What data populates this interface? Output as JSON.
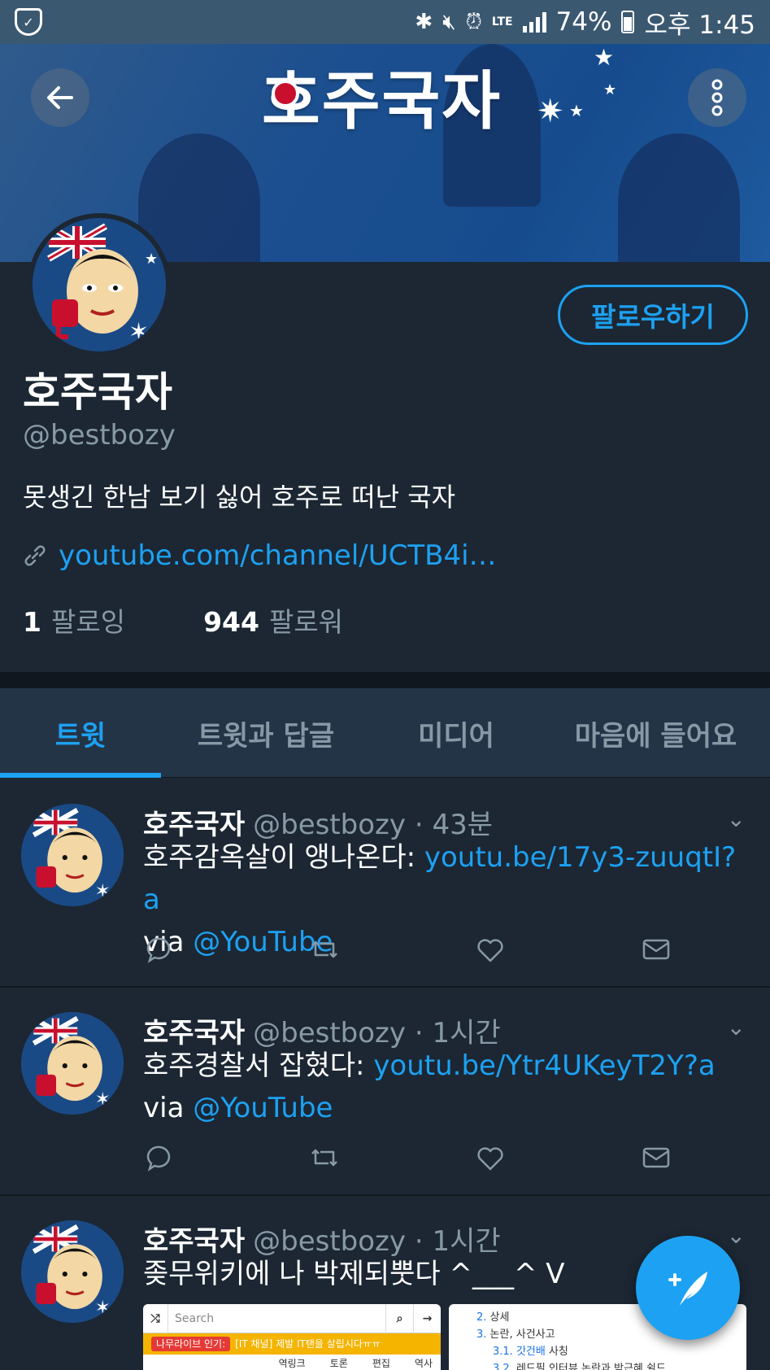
{
  "statusbar": {
    "battery": "74%",
    "network": "LTE",
    "time_text": "오후 1:45"
  },
  "banner": {
    "title": "호주국자"
  },
  "profile": {
    "name": "호주국자",
    "handle": "@bestbozy",
    "bio": "못생긴 한남 보기 싫어 호주로 떠난 국자",
    "link": "youtube.com/channel/UCTB4i…",
    "following_count": "1",
    "following_label": "팔로잉",
    "followers_count": "944",
    "followers_label": "팔로워",
    "follow_button": "팔로우하기"
  },
  "tabs": [
    {
      "label": "트윗"
    },
    {
      "label": "트윗과 답글"
    },
    {
      "label": "미디어"
    },
    {
      "label": "마음에 들어요"
    }
  ],
  "tweets": [
    {
      "name": "호주국자",
      "handle": "@bestbozy",
      "time": "· 43분",
      "text": "호주감옥살이 앵나온다: ",
      "link": "youtu.be/17y3-zuuqtI?a",
      "via": "via ",
      "mention": "@YouTube"
    },
    {
      "name": "호주국자",
      "handle": "@bestbozy",
      "time": "· 1시간",
      "text": "호주경찰서 잡혔다: ",
      "link": "youtu.be/Ytr4UKeyT2Y?a",
      "via": "via ",
      "mention": "@YouTube"
    },
    {
      "name": "호주국자",
      "handle": "@bestbozy",
      "time": "· 1시간",
      "text": "좆무위키에 나 박제되뿟다 ^___^ V"
    }
  ],
  "thumb1": {
    "search_placeholder": "Search",
    "banner_pill": "나무라이브 인기:",
    "banner_text": "[IT 채널] 제발 IT탠을 살립시다ㅠㅠ",
    "cols": [
      "역링크",
      "토론",
      "편집",
      "역사"
    ]
  },
  "thumb2": {
    "toc": [
      {
        "num": "2.",
        "text": "상세"
      },
      {
        "num": "3.",
        "text": "논란, 사건사고"
      },
      {
        "num": "3.1.",
        "link": "갓건배",
        "text": " 사칭"
      },
      {
        "num": "3.2.",
        "text": "레드필 인터뷰 논란과 박근혜 쉴드"
      }
    ]
  },
  "colors": {
    "background": "#1c2733",
    "accent": "#1da1f2",
    "secondary_text": "#8899a6"
  }
}
